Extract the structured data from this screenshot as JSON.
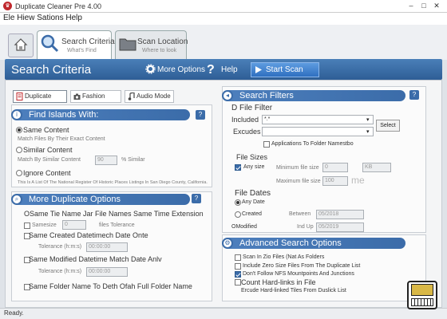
{
  "window": {
    "title": "Duplicate Cleaner Pre 4.00",
    "app_icon": "♛",
    "minimize": "–",
    "maximize": "□",
    "close": "✕"
  },
  "menu": {
    "text": "Ele Hiew Sations Help"
  },
  "tabs": [
    {
      "title": "Search Criteria",
      "sub": "What's Find"
    },
    {
      "title": "Scan Location",
      "sub": "Where to look"
    }
  ],
  "header": {
    "title": "Search Criteria",
    "more_options": "More Options",
    "help_q": "?",
    "help": "Help",
    "start_scan": "Start Scan"
  },
  "modes": [
    {
      "label": "Duplicate Mode"
    },
    {
      "label": "Fashion Image"
    },
    {
      "label": "Audio Mode"
    }
  ],
  "find": {
    "header": "Find Islands With:",
    "same_content": "Same Content",
    "same_desc": "Match Files By Their Exact Content",
    "similar_content": "Similar Content",
    "similar_desc": "Match By Similar Content",
    "similar_value": "90",
    "similar_unit": "% Similar",
    "ignore_content": "Ignore Content",
    "ignore_desc": "This Is A List Of The National Register Of Historic Places Listings In San Diego County, California."
  },
  "more": {
    "header": "More Duplicate Options",
    "same_name": "OSame Tie Name Jar File Names Same Time Extension",
    "same_size": "Samesize",
    "size_val": "0",
    "size_tol": "files Tolerance",
    "created_date": "Same Created Datetimech Date Onte",
    "tol_label": "Tolerance (h:m:s)",
    "tol1": "00:00:00",
    "modified_date": "Same Modified Datetime Match Date Anlv",
    "tol2": "00:00:00",
    "folder_name": "Same Folder Name To Deth Ofah Full Folder Name"
  },
  "filters": {
    "header": "Search Filters",
    "file_filter": "D File Filter",
    "included": "Included",
    "included_val": "*.*",
    "excludes": "Excudes",
    "excludes_val": "",
    "select": "Select",
    "applications": "Applications To Folder Namestbo",
    "file_sizes": "File Sizes",
    "any_size": "Any size",
    "min_label": "Minimum file size",
    "min_val": "0",
    "min_unit": "KB",
    "max_label": "Maximum file size",
    "max_val": "100",
    "max_unit": "me",
    "file_dates": "File Dates",
    "any_date": "Any Date",
    "created": "Created",
    "created_rel": "Between",
    "created_val": "05/2018",
    "modified": "OModified",
    "modified_rel": "Ind Up",
    "modified_val": "05/2019"
  },
  "advanced": {
    "header": "Advanced Search Options",
    "opt1": "Scan In Zio Files (Nat As Folders",
    "opt2": "Include Zero Size Files From The Duplicate List",
    "opt3": "Don't Follow NFS Mountpoints And Junctions",
    "opt4": "Count Hard-links in File",
    "opt5": "Ercude Hard-linked Tiles From Duslick List"
  },
  "status": {
    "text": "Ready."
  },
  "colors": {
    "accent": "#3b6ca9",
    "header_gradient_top": "#4a7fb8",
    "start_button": "#2f6fc0"
  }
}
